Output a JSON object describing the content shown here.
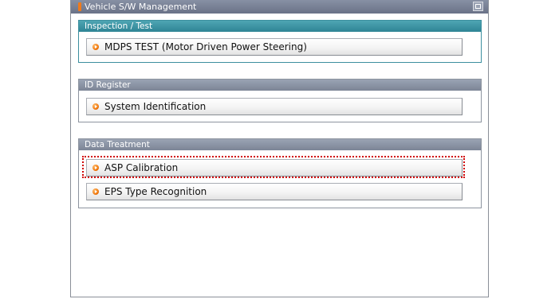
{
  "window": {
    "title": "Vehicle S/W Management"
  },
  "groups": [
    {
      "header": "Inspection / Test",
      "items": [
        {
          "label": "MDPS TEST (Motor Driven Power Steering)"
        }
      ]
    },
    {
      "header": "ID Register",
      "items": [
        {
          "label": "System Identification"
        }
      ]
    },
    {
      "header": "Data Treatment",
      "items": [
        {
          "label": "ASP Calibration",
          "highlighted": true
        },
        {
          "label": "EPS Type Recognition"
        }
      ]
    }
  ],
  "colors": {
    "title_marker": "#f07a1a",
    "active_group_header": "#2f8495",
    "group_header": "#7c8596",
    "highlight_border": "#d00000",
    "bullet": "#f07a1a"
  },
  "icons": {
    "window_button": "window-restore-icon",
    "item_bullet": "orange-arrow-bullet-icon"
  }
}
